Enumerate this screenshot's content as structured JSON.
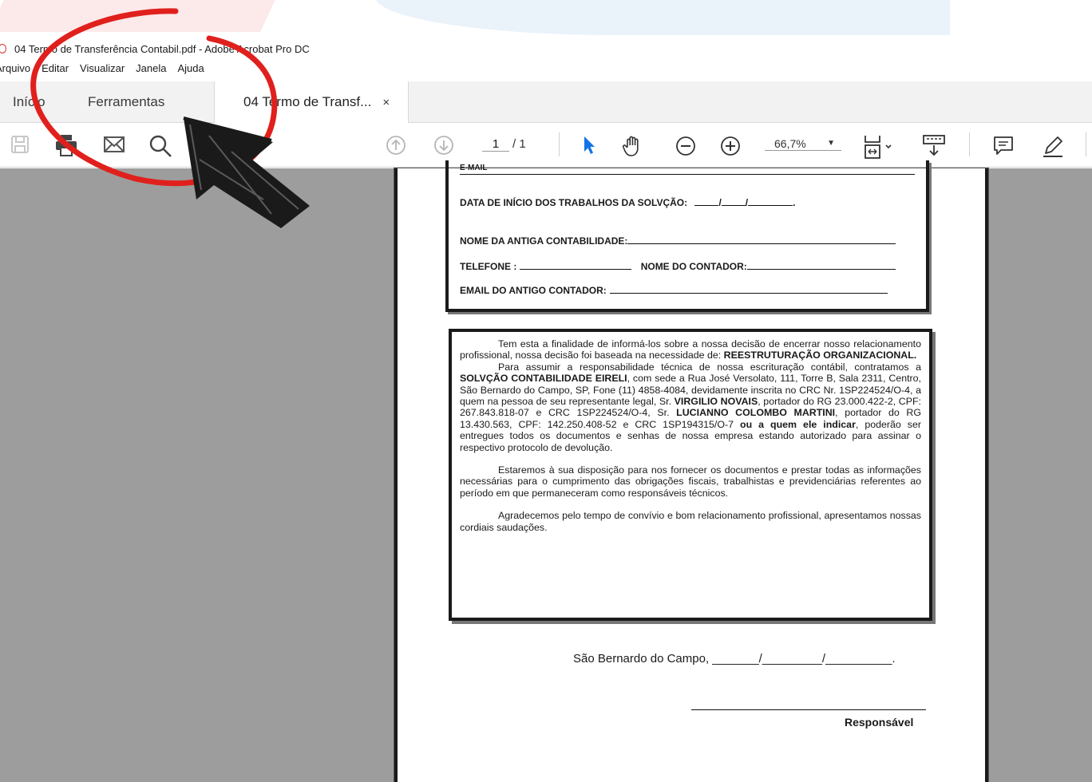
{
  "window": {
    "title": "04 Termo de Transferência Contabil.pdf - Adobe Acrobat Pro DC"
  },
  "menu": [
    "Arquivo",
    "Editar",
    "Visualizar",
    "Janela",
    "Ajuda"
  ],
  "tabs": {
    "home": "Início",
    "tools": "Ferramentas",
    "document": "04 Termo de Transf...",
    "close_glyph": "×"
  },
  "toolbar": {
    "page_current": "1",
    "page_total": "/ 1",
    "zoom": "66,7%",
    "icons": [
      "save-icon",
      "print-icon",
      "email-icon",
      "search-icon",
      "page-up-icon",
      "page-down-icon",
      "select-cursor-icon",
      "hand-icon",
      "zoom-out-icon",
      "zoom-in-icon",
      "fit-page-icon",
      "scroll-mode-icon",
      "comment-icon",
      "highlight-pen-icon"
    ]
  },
  "document": {
    "fields": {
      "email_label": "E-MAIL",
      "start_date": "DATA DE INÍCIO DOS TRABALHOS DA SOLVÇÃO:",
      "previous_firm": "NOME DA ANTIGA CONTABILIDADE:",
      "phone": "TELEFONE :",
      "accountant": "NOME DO CONTADOR:",
      "previous_email": "EMAIL DO ANTIGO CONTADOR:"
    },
    "letter": {
      "p1_text": "Tem esta a finalidade de informá-los sobre a nossa decisão de encerrar nosso relacionamento profissional, nossa decisão foi baseada na necessidade de: ",
      "p1_bold": "REESTRUTURAÇÃO ORGANIZACIONAL.",
      "p2_a": "Para assumir a responsabilidade técnica de nossa escrituração contábil, contratamos a ",
      "p2_company": "SOLVÇÃO CONTABILIDADE EIRELI",
      "p2_b": ", com sede a Rua José Versolato, 111, Torre B, Sala 2311, Centro, São Bernardo do Campo, SP, Fone (11) 4858-4084, devidamente inscrita no CRC Nr. 1SP224524/O-4, a quem na pessoa de seu representante legal, Sr. ",
      "p2_rep1": "VIRGILIO NOVAIS",
      "p2_c": ", portador do RG 23.000.422-2, CPF: 267.843.818-07 e CRC 1SP224524/O-4, Sr. ",
      "p2_rep2": "LUCIANNO COLOMBO MARTINI",
      "p2_d": ", portador do RG 13.430.563, CPF: 142.250.408-52 e CRC 1SP194315/O-7 ",
      "p2_bold": "ou a quem ele indicar",
      "p2_e": ", poderão ser entregues todos os documentos e senhas de nossa empresa estando autorizado para assinar o respectivo protocolo de devolução.",
      "p3": "Estaremos à sua disposição para nos fornecer os documentos e prestar todas as informações necessárias para o cumprimento das obrigações fiscais, trabalhistas e previdenciárias referentes ao período em que permaneceram como responsáveis técnicos.",
      "p4": "Agradecemos pelo tempo de convívio e bom relacionamento profissional, apresentamos nossas cordiais saudações."
    },
    "place": "São Bernardo do Campo, _______/_________/__________.",
    "signature_label": "Responsável"
  },
  "colors": {
    "annotation_red": "#e0201d",
    "viewer_bg": "#9d9d9d",
    "pointer_blue": "#1473e6"
  }
}
